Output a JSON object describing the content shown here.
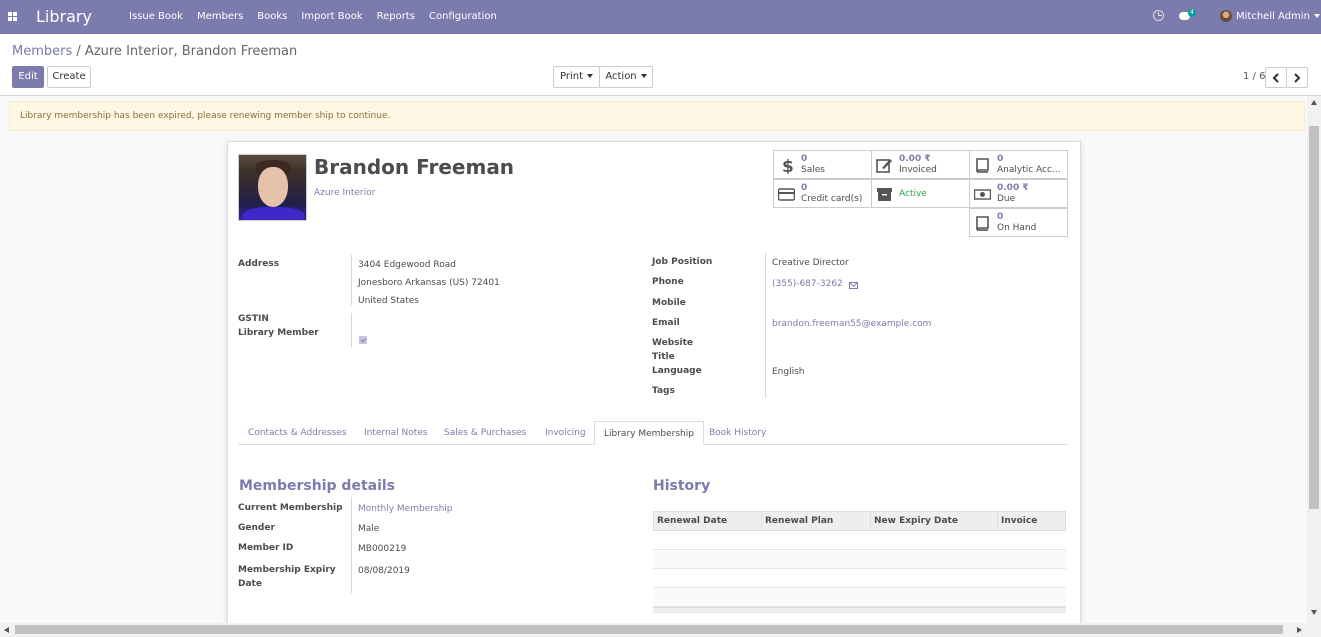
{
  "navbar": {
    "app_title": "Library",
    "menu": [
      "Issue Book",
      "Members",
      "Books",
      "Import Book",
      "Reports",
      "Configuration"
    ],
    "chat_count": "4",
    "user_name": "Mitchell Admin",
    "icons": [
      "apps-icon",
      "clock-icon",
      "chat-icon",
      "avatar"
    ]
  },
  "control": {
    "breadcrumb_parent": "Members",
    "breadcrumb_separator": "/",
    "breadcrumb_current": "Azure Interior, Brandon Freeman",
    "edit_label": "Edit",
    "create_label": "Create",
    "print_label": "Print",
    "action_label": "Action",
    "pager": "1 / 6"
  },
  "alert": {
    "message": "Library membership has been expired, please renewing member ship to continue."
  },
  "partner": {
    "name": "Brandon Freeman",
    "company": "Azure Interior"
  },
  "stats": {
    "sales": {
      "value": "0",
      "label": "Sales",
      "icon": "dollar-icon"
    },
    "invoiced": {
      "value": "0.00 ₹",
      "label": "Invoiced",
      "icon": "pencil-square-icon"
    },
    "analytic": {
      "value": "0",
      "label": "Analytic Acc...",
      "icon": "book-icon"
    },
    "credit": {
      "value": "0",
      "label": "Credit card(s)",
      "icon": "credit-card-icon"
    },
    "active": {
      "label": "Active",
      "icon": "archive-icon"
    },
    "due": {
      "value": "0.00 ₹",
      "label": "Due",
      "icon": "money-icon"
    },
    "onhand": {
      "value": "0",
      "label": "On Hand",
      "icon": "book-icon"
    }
  },
  "left_fields": {
    "address_label": "Address",
    "street": "3404 Edgewood Road",
    "city_line": "Jonesboro  Arkansas (US)  72401",
    "country": "United States",
    "gstin_label": "GSTIN",
    "library_member_label": "Library Member",
    "library_member_checked": true
  },
  "right_fields": {
    "job_position_label": "Job Position",
    "job_position": "Creative Director",
    "phone_label": "Phone",
    "phone": "(355)-687-3262",
    "mobile_label": "Mobile",
    "email_label": "Email",
    "email": "brandon.freeman55@example.com",
    "website_label": "Website",
    "title_label": "Title",
    "language_label": "Language",
    "language": "English",
    "tags_label": "Tags"
  },
  "tabs": [
    "Contacts & Addresses",
    "Internal Notes",
    "Sales & Purchases",
    "Invoicing",
    "Library Membership",
    "Book History"
  ],
  "active_tab": "Library Membership",
  "membership": {
    "title": "Membership details",
    "current_label": "Current Membership",
    "current": "Monthly Membership",
    "gender_label": "Gender",
    "gender": "Male",
    "member_id_label": "Member ID",
    "member_id": "MB000219",
    "expiry_label_1": "Membership Expiry",
    "expiry_label_2": "Date",
    "expiry": "08/08/2019"
  },
  "history": {
    "title": "History",
    "columns": [
      "Renewal Date",
      "Renewal Plan",
      "New Expiry Date",
      "Invoice"
    ],
    "rows": [
      [],
      [],
      [],
      []
    ]
  },
  "colors": {
    "brand": "#7c7bad",
    "alert_bg": "#fcf8e3",
    "alert_text": "#8a6d3b",
    "active_green": "#28a745"
  }
}
